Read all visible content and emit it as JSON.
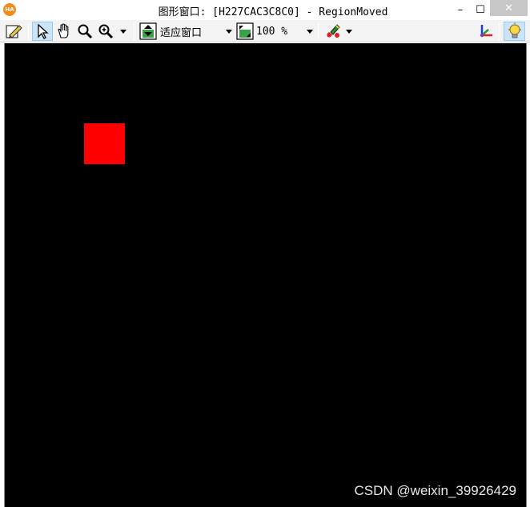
{
  "window": {
    "app_icon_text": "HA",
    "title": "图形窗口: [H227CAC3C8C0] - RegionMoved",
    "minimize_glyph": "–",
    "maximize_glyph": "☐",
    "close_glyph": "✕"
  },
  "toolbar": {
    "fit_mode_label": "适应窗口",
    "zoom_label": "100 %",
    "active_tool": "select-pointer"
  },
  "canvas": {
    "background_color": "#000000",
    "region_color": "#ff0000"
  },
  "watermark": {
    "text": "CSDN @weixin_39926429"
  }
}
